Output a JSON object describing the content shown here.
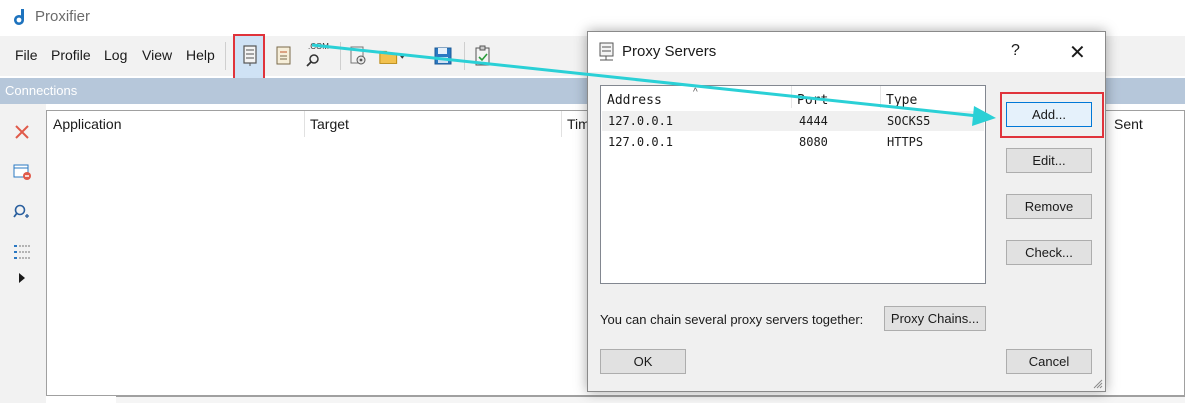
{
  "app": {
    "title": "Proxifier"
  },
  "menu": {
    "items": [
      "File",
      "Profile",
      "Log",
      "View",
      "Help"
    ]
  },
  "toolbar": {
    "buttons": [
      "proxy-servers",
      "proxification-rules",
      "name-resolution",
      "advanced",
      "open-profile",
      "save-profile",
      "profile-check"
    ],
    "dns_badge": ".COM"
  },
  "section": {
    "label": "Connections"
  },
  "connections_table": {
    "columns": [
      "Application",
      "Target",
      "Tim",
      "Sent"
    ]
  },
  "dialog": {
    "title": "Proxy Servers",
    "help": "?",
    "close": "✕",
    "columns": [
      "Address",
      "Port",
      "Type"
    ],
    "rows": [
      {
        "address": "127.0.0.1",
        "port": "4444",
        "type": "SOCKS5"
      },
      {
        "address": "127.0.0.1",
        "port": "8080",
        "type": "HTTPS"
      }
    ],
    "buttons": {
      "add": "Add...",
      "edit": "Edit...",
      "remove": "Remove",
      "check": "Check...",
      "ok": "OK",
      "cancel": "Cancel",
      "proxy_chains": "Proxy Chains..."
    },
    "chain_hint": "You can chain several proxy servers together:"
  },
  "colors": {
    "accent": "#0078d7",
    "highlight": "#e0333b",
    "arrow": "#2ad0d6",
    "section_bar": "#b6c7da"
  }
}
